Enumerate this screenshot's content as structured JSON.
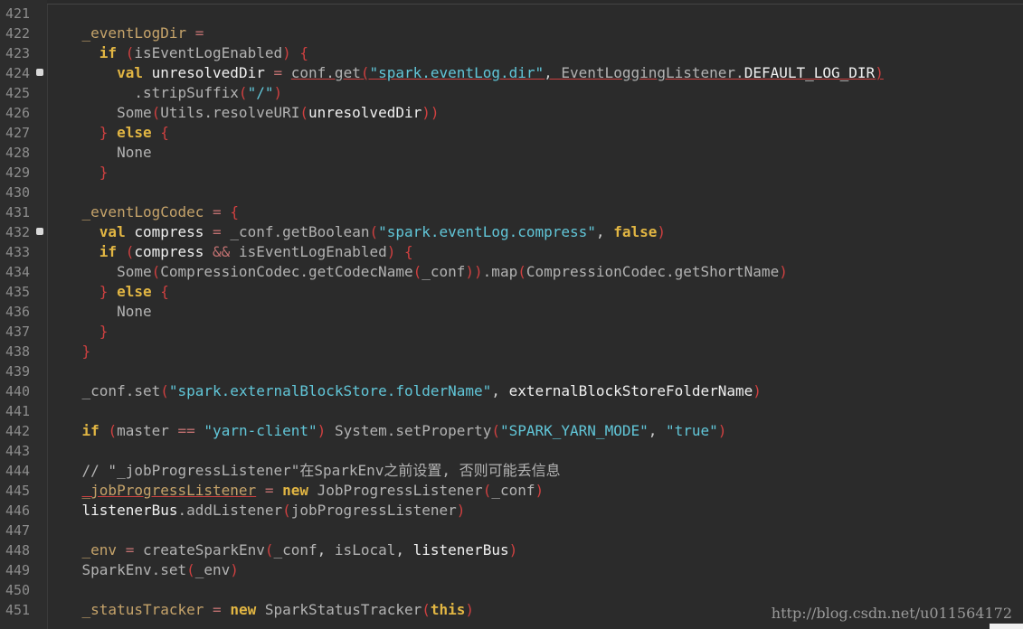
{
  "editor": {
    "lines": [
      {
        "n": "421",
        "fold": false,
        "segs": []
      },
      {
        "n": "422",
        "fold": false,
        "segs": [
          {
            "t": "    ",
            "c": ""
          },
          {
            "t": "_eventLogDir",
            "c": "fl"
          },
          {
            "t": " ",
            "c": ""
          },
          {
            "t": "=",
            "c": "o"
          }
        ]
      },
      {
        "n": "423",
        "fold": false,
        "segs": [
          {
            "t": "      ",
            "c": ""
          },
          {
            "t": "if",
            "c": "k"
          },
          {
            "t": " ",
            "c": ""
          },
          {
            "t": "(",
            "c": "b"
          },
          {
            "t": "isEventLogEnabled",
            "c": "f"
          },
          {
            "t": ")",
            "c": "b"
          },
          {
            "t": " ",
            "c": ""
          },
          {
            "t": "{",
            "c": "b"
          }
        ]
      },
      {
        "n": "424",
        "fold": true,
        "segs": [
          {
            "t": "        ",
            "c": ""
          },
          {
            "t": "val",
            "c": "k"
          },
          {
            "t": " ",
            "c": ""
          },
          {
            "t": "unresolvedDir",
            "c": "wh"
          },
          {
            "t": " ",
            "c": ""
          },
          {
            "t": "=",
            "c": "o"
          },
          {
            "t": " ",
            "c": ""
          },
          {
            "t": "conf.get",
            "c": "f ul"
          },
          {
            "t": "(",
            "c": "b ul"
          },
          {
            "t": "\"spark.eventLog.dir\"",
            "c": "s ul"
          },
          {
            "t": ", ",
            "c": "p ul"
          },
          {
            "t": "EventLoggingListener.",
            "c": "f ul"
          },
          {
            "t": "DEFAULT_LOG_DIR",
            "c": "wh ul"
          },
          {
            "t": ")",
            "c": "b ul"
          }
        ]
      },
      {
        "n": "425",
        "fold": false,
        "segs": [
          {
            "t": "          ",
            "c": ""
          },
          {
            "t": ".stripSuffix",
            "c": "f"
          },
          {
            "t": "(",
            "c": "b"
          },
          {
            "t": "\"/\"",
            "c": "s"
          },
          {
            "t": ")",
            "c": "b"
          }
        ]
      },
      {
        "n": "426",
        "fold": false,
        "segs": [
          {
            "t": "        ",
            "c": ""
          },
          {
            "t": "Some",
            "c": "f"
          },
          {
            "t": "(",
            "c": "b"
          },
          {
            "t": "Utils.resolveURI",
            "c": "f"
          },
          {
            "t": "(",
            "c": "b"
          },
          {
            "t": "unresolvedDir",
            "c": "wh"
          },
          {
            "t": "))",
            "c": "b"
          }
        ]
      },
      {
        "n": "427",
        "fold": false,
        "segs": [
          {
            "t": "      ",
            "c": ""
          },
          {
            "t": "}",
            "c": "b"
          },
          {
            "t": " ",
            "c": ""
          },
          {
            "t": "else",
            "c": "k"
          },
          {
            "t": " ",
            "c": ""
          },
          {
            "t": "{",
            "c": "b"
          }
        ]
      },
      {
        "n": "428",
        "fold": false,
        "segs": [
          {
            "t": "        ",
            "c": ""
          },
          {
            "t": "None",
            "c": "f"
          }
        ]
      },
      {
        "n": "429",
        "fold": false,
        "segs": [
          {
            "t": "      ",
            "c": ""
          },
          {
            "t": "}",
            "c": "b"
          }
        ]
      },
      {
        "n": "430",
        "fold": false,
        "segs": []
      },
      {
        "n": "431",
        "fold": false,
        "segs": [
          {
            "t": "    ",
            "c": ""
          },
          {
            "t": "_eventLogCodec",
            "c": "fl"
          },
          {
            "t": " ",
            "c": ""
          },
          {
            "t": "=",
            "c": "o"
          },
          {
            "t": " ",
            "c": ""
          },
          {
            "t": "{",
            "c": "b"
          }
        ]
      },
      {
        "n": "432",
        "fold": true,
        "segs": [
          {
            "t": "      ",
            "c": ""
          },
          {
            "t": "val",
            "c": "k"
          },
          {
            "t": " ",
            "c": ""
          },
          {
            "t": "compress",
            "c": "wh"
          },
          {
            "t": " ",
            "c": ""
          },
          {
            "t": "=",
            "c": "o"
          },
          {
            "t": " ",
            "c": ""
          },
          {
            "t": "_conf.getBoolean",
            "c": "f"
          },
          {
            "t": "(",
            "c": "b"
          },
          {
            "t": "\"spark.eventLog.compress\"",
            "c": "s"
          },
          {
            "t": ", ",
            "c": "p"
          },
          {
            "t": "false",
            "c": "k"
          },
          {
            "t": ")",
            "c": "b"
          }
        ]
      },
      {
        "n": "433",
        "fold": false,
        "segs": [
          {
            "t": "      ",
            "c": ""
          },
          {
            "t": "if",
            "c": "k"
          },
          {
            "t": " ",
            "c": ""
          },
          {
            "t": "(",
            "c": "b"
          },
          {
            "t": "compress",
            "c": "wh"
          },
          {
            "t": " ",
            "c": ""
          },
          {
            "t": "&&",
            "c": "o"
          },
          {
            "t": " ",
            "c": ""
          },
          {
            "t": "isEventLogEnabled",
            "c": "f"
          },
          {
            "t": ")",
            "c": "b"
          },
          {
            "t": " ",
            "c": ""
          },
          {
            "t": "{",
            "c": "b"
          }
        ]
      },
      {
        "n": "434",
        "fold": false,
        "segs": [
          {
            "t": "        ",
            "c": ""
          },
          {
            "t": "Some",
            "c": "f"
          },
          {
            "t": "(",
            "c": "b"
          },
          {
            "t": "CompressionCodec.getCodecName",
            "c": "f"
          },
          {
            "t": "(",
            "c": "b"
          },
          {
            "t": "_conf",
            "c": "f"
          },
          {
            "t": "))",
            "c": "b"
          },
          {
            "t": ".map",
            "c": "f"
          },
          {
            "t": "(",
            "c": "b"
          },
          {
            "t": "CompressionCodec.getShortName",
            "c": "f"
          },
          {
            "t": ")",
            "c": "b"
          }
        ]
      },
      {
        "n": "435",
        "fold": false,
        "segs": [
          {
            "t": "      ",
            "c": ""
          },
          {
            "t": "}",
            "c": "b"
          },
          {
            "t": " ",
            "c": ""
          },
          {
            "t": "else",
            "c": "k"
          },
          {
            "t": " ",
            "c": ""
          },
          {
            "t": "{",
            "c": "b"
          }
        ]
      },
      {
        "n": "436",
        "fold": false,
        "segs": [
          {
            "t": "        ",
            "c": ""
          },
          {
            "t": "None",
            "c": "f"
          }
        ]
      },
      {
        "n": "437",
        "fold": false,
        "segs": [
          {
            "t": "      ",
            "c": ""
          },
          {
            "t": "}",
            "c": "b"
          }
        ]
      },
      {
        "n": "438",
        "fold": false,
        "segs": [
          {
            "t": "    ",
            "c": ""
          },
          {
            "t": "}",
            "c": "b"
          }
        ]
      },
      {
        "n": "439",
        "fold": false,
        "segs": []
      },
      {
        "n": "440",
        "fold": false,
        "segs": [
          {
            "t": "    ",
            "c": ""
          },
          {
            "t": "_conf.set",
            "c": "f"
          },
          {
            "t": "(",
            "c": "b"
          },
          {
            "t": "\"spark.externalBlockStore.folderName\"",
            "c": "s"
          },
          {
            "t": ", ",
            "c": "p"
          },
          {
            "t": "externalBlockStoreFolderName",
            "c": "wh"
          },
          {
            "t": ")",
            "c": "b"
          }
        ]
      },
      {
        "n": "441",
        "fold": false,
        "segs": []
      },
      {
        "n": "442",
        "fold": false,
        "segs": [
          {
            "t": "    ",
            "c": ""
          },
          {
            "t": "if",
            "c": "k"
          },
          {
            "t": " ",
            "c": ""
          },
          {
            "t": "(",
            "c": "b"
          },
          {
            "t": "master",
            "c": "f"
          },
          {
            "t": " ",
            "c": ""
          },
          {
            "t": "==",
            "c": "o"
          },
          {
            "t": " ",
            "c": ""
          },
          {
            "t": "\"yarn-client\"",
            "c": "s"
          },
          {
            "t": ")",
            "c": "b"
          },
          {
            "t": " ",
            "c": ""
          },
          {
            "t": "System.setProperty",
            "c": "f"
          },
          {
            "t": "(",
            "c": "b"
          },
          {
            "t": "\"SPARK_YARN_MODE\"",
            "c": "s"
          },
          {
            "t": ", ",
            "c": "p"
          },
          {
            "t": "\"true\"",
            "c": "s"
          },
          {
            "t": ")",
            "c": "b"
          }
        ]
      },
      {
        "n": "443",
        "fold": false,
        "segs": []
      },
      {
        "n": "444",
        "fold": false,
        "segs": [
          {
            "t": "    ",
            "c": ""
          },
          {
            "t": "// \"_jobProgressListener\"在SparkEnv之前设置, 否则可能丢信息",
            "c": "c"
          }
        ]
      },
      {
        "n": "445",
        "fold": false,
        "segs": [
          {
            "t": "    ",
            "c": ""
          },
          {
            "t": "_jobProgressListener",
            "c": "fl ul"
          },
          {
            "t": " ",
            "c": ""
          },
          {
            "t": "=",
            "c": "o"
          },
          {
            "t": " ",
            "c": ""
          },
          {
            "t": "new",
            "c": "k"
          },
          {
            "t": " ",
            "c": ""
          },
          {
            "t": "JobProgressListener",
            "c": "f"
          },
          {
            "t": "(",
            "c": "b"
          },
          {
            "t": "_conf",
            "c": "f"
          },
          {
            "t": ")",
            "c": "b"
          }
        ]
      },
      {
        "n": "446",
        "fold": false,
        "segs": [
          {
            "t": "    ",
            "c": ""
          },
          {
            "t": "listenerBus",
            "c": "wh"
          },
          {
            "t": ".addListener",
            "c": "f"
          },
          {
            "t": "(",
            "c": "b"
          },
          {
            "t": "jobProgressListener",
            "c": "f"
          },
          {
            "t": ")",
            "c": "b"
          }
        ]
      },
      {
        "n": "447",
        "fold": false,
        "segs": []
      },
      {
        "n": "448",
        "fold": false,
        "segs": [
          {
            "t": "    ",
            "c": ""
          },
          {
            "t": "_env",
            "c": "fl"
          },
          {
            "t": " ",
            "c": ""
          },
          {
            "t": "=",
            "c": "o"
          },
          {
            "t": " ",
            "c": ""
          },
          {
            "t": "createSparkEnv",
            "c": "f"
          },
          {
            "t": "(",
            "c": "b"
          },
          {
            "t": "_conf",
            "c": "f"
          },
          {
            "t": ", ",
            "c": "p"
          },
          {
            "t": "isLocal",
            "c": "f"
          },
          {
            "t": ", ",
            "c": "p"
          },
          {
            "t": "listenerBus",
            "c": "wh"
          },
          {
            "t": ")",
            "c": "b"
          }
        ]
      },
      {
        "n": "449",
        "fold": false,
        "segs": [
          {
            "t": "    ",
            "c": ""
          },
          {
            "t": "SparkEnv.set",
            "c": "f"
          },
          {
            "t": "(",
            "c": "b"
          },
          {
            "t": "_env",
            "c": "f"
          },
          {
            "t": ")",
            "c": "b"
          }
        ]
      },
      {
        "n": "450",
        "fold": false,
        "segs": []
      },
      {
        "n": "451",
        "fold": false,
        "segs": [
          {
            "t": "    ",
            "c": ""
          },
          {
            "t": "_statusTracker",
            "c": "fl"
          },
          {
            "t": " ",
            "c": ""
          },
          {
            "t": "=",
            "c": "o"
          },
          {
            "t": " ",
            "c": ""
          },
          {
            "t": "new",
            "c": "k"
          },
          {
            "t": " ",
            "c": ""
          },
          {
            "t": "SparkStatusTracker",
            "c": "f"
          },
          {
            "t": "(",
            "c": "b"
          },
          {
            "t": "this",
            "c": "k"
          },
          {
            "t": ")",
            "c": "b"
          }
        ]
      }
    ]
  },
  "watermark": "http://blog.csdn.net/u011564172"
}
